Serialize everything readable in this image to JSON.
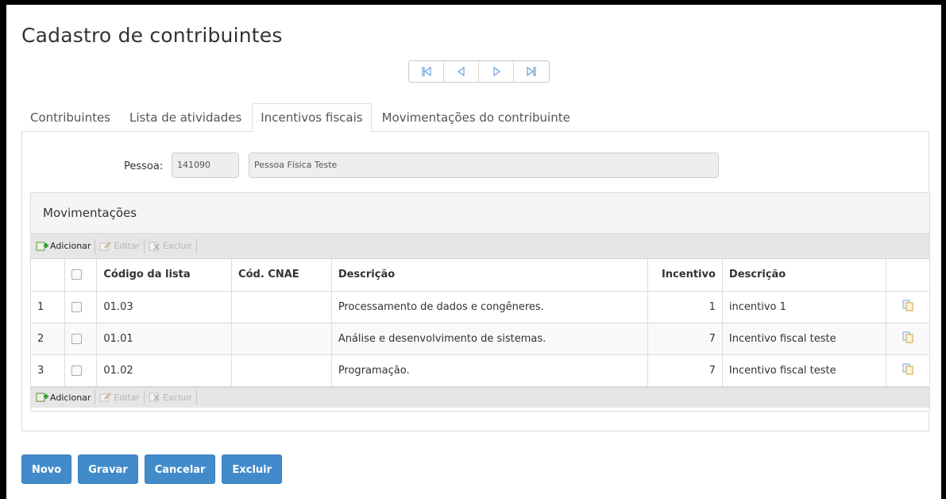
{
  "page": {
    "title": "Cadastro de contribuintes"
  },
  "pager": {
    "icons": [
      "first-page-icon",
      "previous-page-icon",
      "next-page-icon",
      "last-page-icon"
    ]
  },
  "tabs": [
    {
      "label": "Contribuintes",
      "active": false
    },
    {
      "label": "Lista de atividades",
      "active": false
    },
    {
      "label": "Incentivos fiscais",
      "active": true
    },
    {
      "label": "Movimentações do contribuinte",
      "active": false
    }
  ],
  "form": {
    "pessoa_label": "Pessoa:",
    "pessoa_code": "141090",
    "pessoa_name": "Pessoa Física Teste"
  },
  "grid": {
    "title": "Movimentações",
    "toolbar": {
      "add": "Adicionar",
      "edit": "Editar",
      "delete": "Excluir"
    },
    "columns": [
      "Código da lista",
      "Cód. CNAE",
      "Descrição",
      "Incentivo",
      "Descrição"
    ],
    "rows": [
      {
        "n": "1",
        "codigo": "01.03",
        "cnae": "",
        "descricao": "Processamento de dados e congêneres.",
        "incentivo": "1",
        "desc_incentivo": "incentivo 1"
      },
      {
        "n": "2",
        "codigo": "01.01",
        "cnae": "",
        "descricao": "Análise e desenvolvimento de sistemas.",
        "incentivo": "7",
        "desc_incentivo": "Incentivo fiscal teste"
      },
      {
        "n": "3",
        "codigo": "01.02",
        "cnae": "",
        "descricao": "Programação.",
        "incentivo": "7",
        "desc_incentivo": "Incentivo fiscal teste"
      }
    ]
  },
  "actions": {
    "new": "Novo",
    "save": "Gravar",
    "cancel": "Cancelar",
    "delete": "Excluir"
  },
  "colors": {
    "primary": "#428bca",
    "border": "#dddddd",
    "toolbar": "#e6e6e6"
  }
}
